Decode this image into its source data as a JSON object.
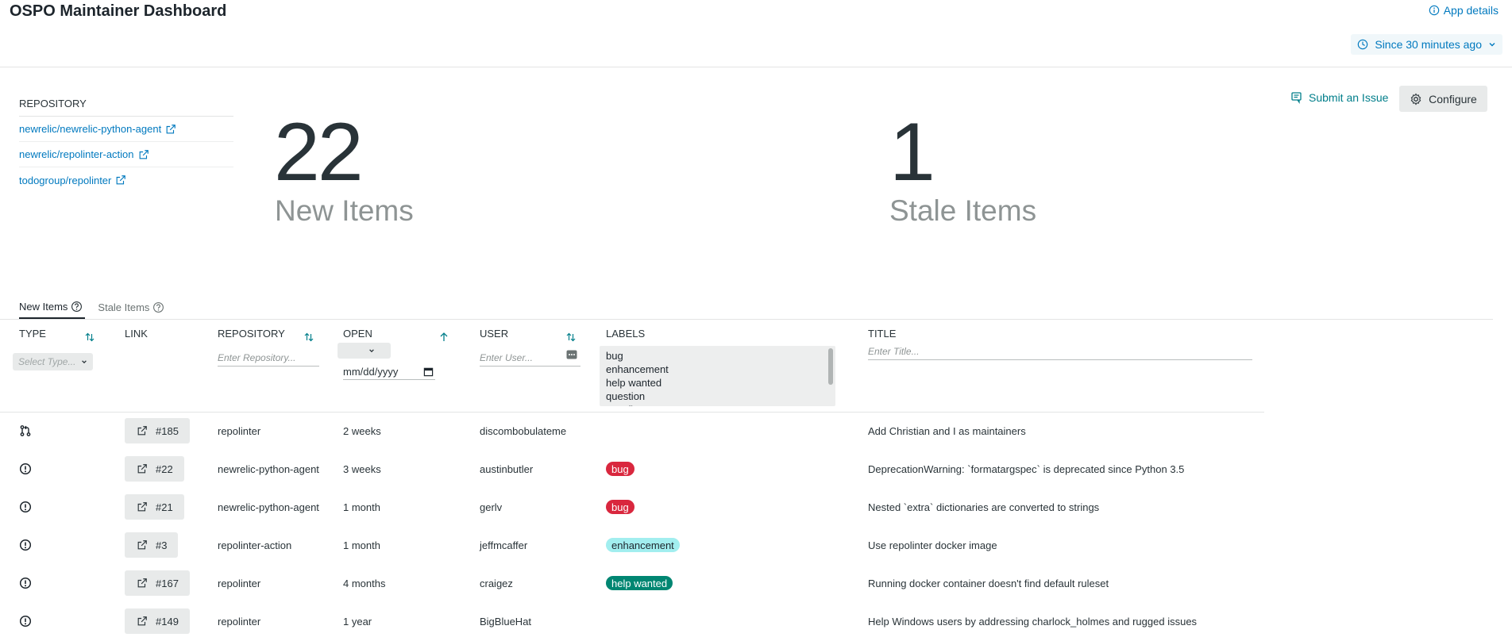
{
  "header": {
    "title": "OSPO Maintainer Dashboard",
    "app_details": "App details",
    "time_picker": "Since 30 minutes ago"
  },
  "repositories": {
    "header": "REPOSITORY",
    "items": [
      {
        "name": "newrelic/newrelic-python-agent"
      },
      {
        "name": "newrelic/repolinter-action"
      },
      {
        "name": "todogroup/repolinter"
      }
    ]
  },
  "summary": {
    "new_count": "22",
    "new_label": "New Items",
    "stale_count": "1",
    "stale_label": "Stale Items"
  },
  "actions": {
    "submit_issue": "Submit an Issue",
    "configure": "Configure"
  },
  "tabs": [
    {
      "label": "New Items",
      "active": true
    },
    {
      "label": "Stale Items",
      "active": false
    }
  ],
  "table": {
    "columns": {
      "type": "TYPE",
      "link": "LINK",
      "repository": "REPOSITORY",
      "open": "OPEN",
      "user": "USER",
      "labels": "LABELS",
      "title": "TITLE"
    },
    "filters": {
      "type_placeholder": "Select Type...",
      "repository_placeholder": "Enter Repository...",
      "date_placeholder": "mm/dd/yyyy",
      "user_placeholder": "Enter User...",
      "title_placeholder": "Enter Title...",
      "label_options": [
        "bug",
        "enhancement",
        "help wanted",
        "question",
        "wontfix"
      ]
    },
    "rows": [
      {
        "type_icon": "pull-request-icon",
        "link": "#185",
        "repository": "repolinter",
        "open": "2 weeks",
        "user": "discombobulateme",
        "label": "",
        "title": "Add Christian and I as maintainers"
      },
      {
        "type_icon": "issue-icon",
        "link": "#22",
        "repository": "newrelic-python-agent",
        "open": "3 weeks",
        "user": "austinbutler",
        "label": "bug",
        "title": "DeprecationWarning: `formatargspec` is deprecated since Python 3.5"
      },
      {
        "type_icon": "issue-icon",
        "link": "#21",
        "repository": "newrelic-python-agent",
        "open": "1 month",
        "user": "gerlv",
        "label": "bug",
        "title": "Nested `extra` dictionaries are converted to strings"
      },
      {
        "type_icon": "issue-icon",
        "link": "#3",
        "repository": "repolinter-action",
        "open": "1 month",
        "user": "jeffmcaffer",
        "label": "enhancement",
        "title": "Use repolinter docker image"
      },
      {
        "type_icon": "issue-icon",
        "link": "#167",
        "repository": "repolinter",
        "open": "4 months",
        "user": "craigez",
        "label": "help wanted",
        "title": "Running docker container doesn't find default ruleset"
      },
      {
        "type_icon": "issue-icon",
        "link": "#149",
        "repository": "repolinter",
        "open": "1 year",
        "user": "BigBlueHat",
        "label": "",
        "title": "Help Windows users by addressing charlock_holmes and rugged issues"
      }
    ]
  },
  "label_colors": {
    "bug": {
      "bg": "#d9273e",
      "fg": "#ffffff"
    },
    "enhancement": {
      "bg": "#a2eeef",
      "fg": "#1d252c"
    },
    "help wanted": {
      "bg": "#008672",
      "fg": "#ffffff"
    }
  }
}
